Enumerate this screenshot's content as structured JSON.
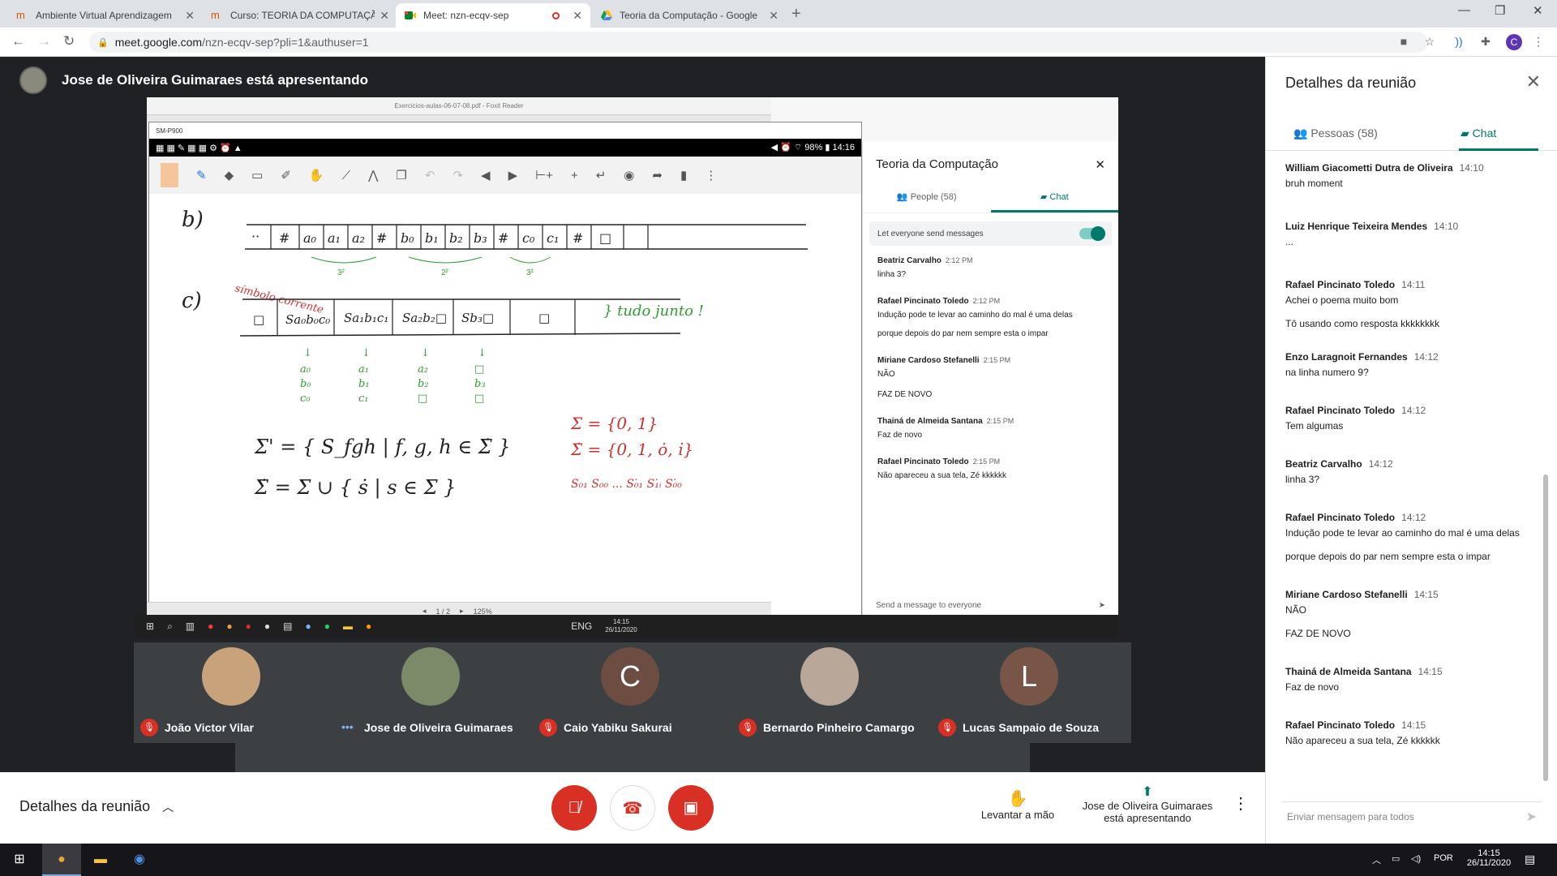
{
  "browser": {
    "tabs": [
      {
        "title": "Ambiente Virtual Aprendizagem",
        "active": false
      },
      {
        "title": "Curso: TEORIA DA COMPUTAÇÃO",
        "active": false
      },
      {
        "title": "Meet: nzn-ecqv-sep",
        "active": true
      },
      {
        "title": "Teoria da Computação - Google",
        "active": false
      }
    ],
    "url_host": "meet.google.com",
    "url_path": "/nzn-ecqv-sep?pli=1&authuser=1",
    "profile_initial": "C"
  },
  "meet": {
    "presenter_banner": "Jose de Oliveira Guimaraes está apresentando",
    "participants": [
      {
        "name": "João Victor Vilar",
        "muted": true,
        "initial": "",
        "color": "#c7a27a"
      },
      {
        "name": "Jose de Oliveira Guimaraes",
        "muted": false,
        "initial": "",
        "color": "#7d8a6a"
      },
      {
        "name": "Caio Yabiku Sakurai",
        "muted": true,
        "initial": "C",
        "color": "#6d4c41"
      },
      {
        "name": "Bernardo Pinheiro Camargo",
        "muted": true,
        "initial": "",
        "color": "#b9a79a"
      },
      {
        "name": "Lucas Sampaio de Souza",
        "muted": true,
        "initial": "L",
        "color": "#795548"
      }
    ],
    "controls": {
      "details_label": "Detalhes da reunião",
      "raise_hand_label": "Levantar a mão",
      "presenting_label_1": "Jose de Oliveira Guimaraes",
      "presenting_label_2": "está apresentando"
    }
  },
  "panel": {
    "title": "Detalhes da reunião",
    "people_tab": "Pessoas (58)",
    "chat_tab": "Chat",
    "send_placeholder": "Enviar mensagem para todos",
    "messages": [
      {
        "who": "William Giacometti Dutra de Oliveira",
        "time": "14:10",
        "text": "bruh moment",
        "extra": ""
      },
      {
        "who": "Luiz Henrique Teixeira Mendes",
        "time": "14:10",
        "text": "...",
        "extra": ""
      },
      {
        "who": "Rafael Pincinato Toledo",
        "time": "14:11",
        "text": "Achei o poema muito bom",
        "extra": "Tô usando como resposta kkkkkkkk"
      },
      {
        "who": "Enzo Laragnoit Fernandes",
        "time": "14:12",
        "text": "na linha numero 9?",
        "extra": ""
      },
      {
        "who": "Rafael Pincinato Toledo",
        "time": "14:12",
        "text": "Tem algumas",
        "extra": ""
      },
      {
        "who": "Beatriz Carvalho",
        "time": "14:12",
        "text": "linha 3?",
        "extra": ""
      },
      {
        "who": "Rafael Pincinato Toledo",
        "time": "14:12",
        "text": "Indução pode te levar ao caminho do mal é uma delas",
        "extra": "porque depois do par nem sempre esta o impar"
      },
      {
        "who": "Miriane Cardoso Stefanelli",
        "time": "14:15",
        "text": "NÃO",
        "extra": "FAZ DE NOVO"
      },
      {
        "who": "Thainá de Almeida Santana",
        "time": "14:15",
        "text": "Faz de novo",
        "extra": ""
      },
      {
        "who": "Rafael Pincinato Toledo",
        "time": "14:15",
        "text": "Não apareceu a sua tela, Zé kkkkkk",
        "extra": ""
      }
    ]
  },
  "shared": {
    "pdf_title": "Exercicios-aulas-06-07-08.pdf - Foxit Reader",
    "tablet_title": "SM-P900",
    "android_time": "14:16",
    "android_battery": "98%",
    "pdf_page": "1 / 2",
    "pdf_zoom": "125%",
    "inner_taskbar_lang": "ENG",
    "inner_taskbar_time": "14:15",
    "inner_taskbar_date": "26/11/2020",
    "inner_meet": {
      "title": "Teoria da Computação",
      "people_tab": "People (58)",
      "chat_tab": "Chat",
      "toggle_label": "Let everyone send messages",
      "send_placeholder": "Send a message to everyone",
      "messages": [
        {
          "who": "Beatriz Carvalho",
          "time": "2:12 PM",
          "text": "linha 3?",
          "extra": ""
        },
        {
          "who": "Rafael Pincinato Toledo",
          "time": "2:12 PM",
          "text": "Indução pode te levar ao caminho do mal é uma delas",
          "extra": "porque depois do par nem sempre esta o impar"
        },
        {
          "who": "Miriane Cardoso Stefanelli",
          "time": "2:15 PM",
          "text": "NÃO",
          "extra": "FAZ DE NOVO"
        },
        {
          "who": "Thainá de Almeida Santana",
          "time": "2:15 PM",
          "text": "Faz de novo",
          "extra": ""
        },
        {
          "who": "Rafael Pincinato Toledo",
          "time": "2:15 PM",
          "text": "Não apareceu a sua tela, Zé kkkkkk",
          "extra": ""
        }
      ]
    }
  },
  "taskbar": {
    "lang": "POR",
    "time": "14:15",
    "date": "26/11/2020"
  }
}
